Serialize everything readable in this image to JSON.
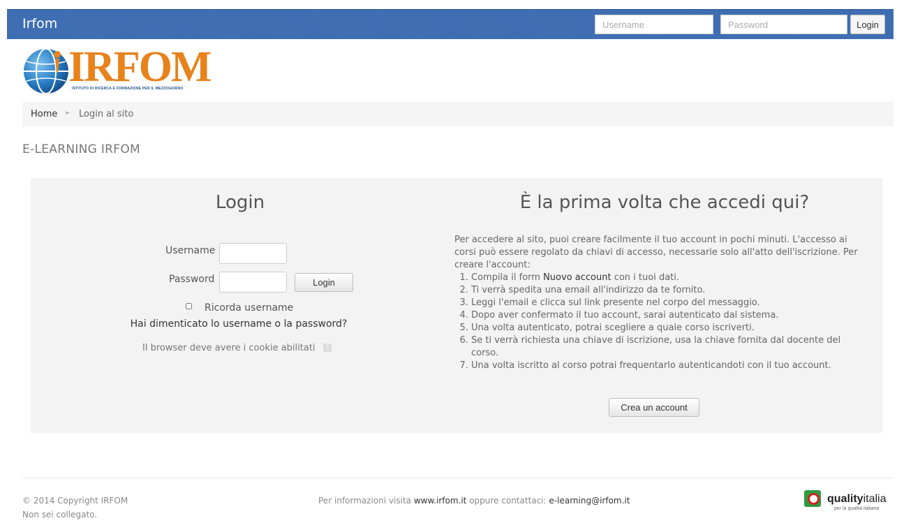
{
  "navbar": {
    "brand": "Irfom",
    "username_placeholder": "Username",
    "password_placeholder": "Password",
    "login_label": "Login",
    "color": "#3c6cb1"
  },
  "logo": {
    "text": "IRFOM",
    "subtitle": "ISTITUTO DI RICERCA E FORMAZIONE PER IL MEZZOGIORNO",
    "icon": "globe-icon",
    "color": "#e8821c"
  },
  "breadcrumb": {
    "home": "Home",
    "separator": "►",
    "current": "Login al sito"
  },
  "site_heading": "E-LEARNING IRFOM",
  "login": {
    "title": "Login",
    "username_label": "Username",
    "password_label": "Password",
    "submit_label": "Login",
    "remember_label": "Ricorda username",
    "forgot_link": "Hai dimenticato lo username o la password?",
    "cookie_note": "Il browser deve avere i cookie abilitati",
    "help_icon": "?"
  },
  "signup": {
    "title": "È la prima volta che accedi qui?",
    "intro": "Per accedere al sito, puoi creare facilmente il tuo account in pochi minuti. L'accesso ai corsi può essere regolato da chiavi di accesso, necessarie solo all'atto dell'iscrizione. Per creare l'account:",
    "steps": [
      {
        "before": "Compila il form ",
        "link": "Nuovo account",
        "after": " con i tuoi dati."
      },
      {
        "text": "Ti verrà spedita una email all'indirizzo da te fornito."
      },
      {
        "text": "Leggi l'email e clicca sul link presente nel corpo del messaggio."
      },
      {
        "text": "Dopo aver confermato il tuo account, sarai autenticato dal sistema."
      },
      {
        "text": "Una volta autenticato, potrai scegliere a quale corso iscriverti."
      },
      {
        "text": "Se ti verrà richiesta una chiave di iscrizione, usa la chiave fornita dal docente del corso."
      },
      {
        "text": "Una volta iscritto al corso potrai frequentarlo autenticandoti con il tuo account."
      }
    ],
    "create_label": "Crea un account"
  },
  "footer": {
    "copyright": "© 2014 Copyright IRFOM",
    "status": "Non sei collegato.",
    "info_prefix": "Per informazioni visita ",
    "website": "www.irfom.it",
    "info_middle": " oppure contattaci: ",
    "email": "e-learning@irfom.it",
    "partner_logo_bold": "quality",
    "partner_logo_light": "italia",
    "partner_tagline": "per la qualità italiana",
    "partner_icon": "qualityitalia-logo-icon"
  }
}
